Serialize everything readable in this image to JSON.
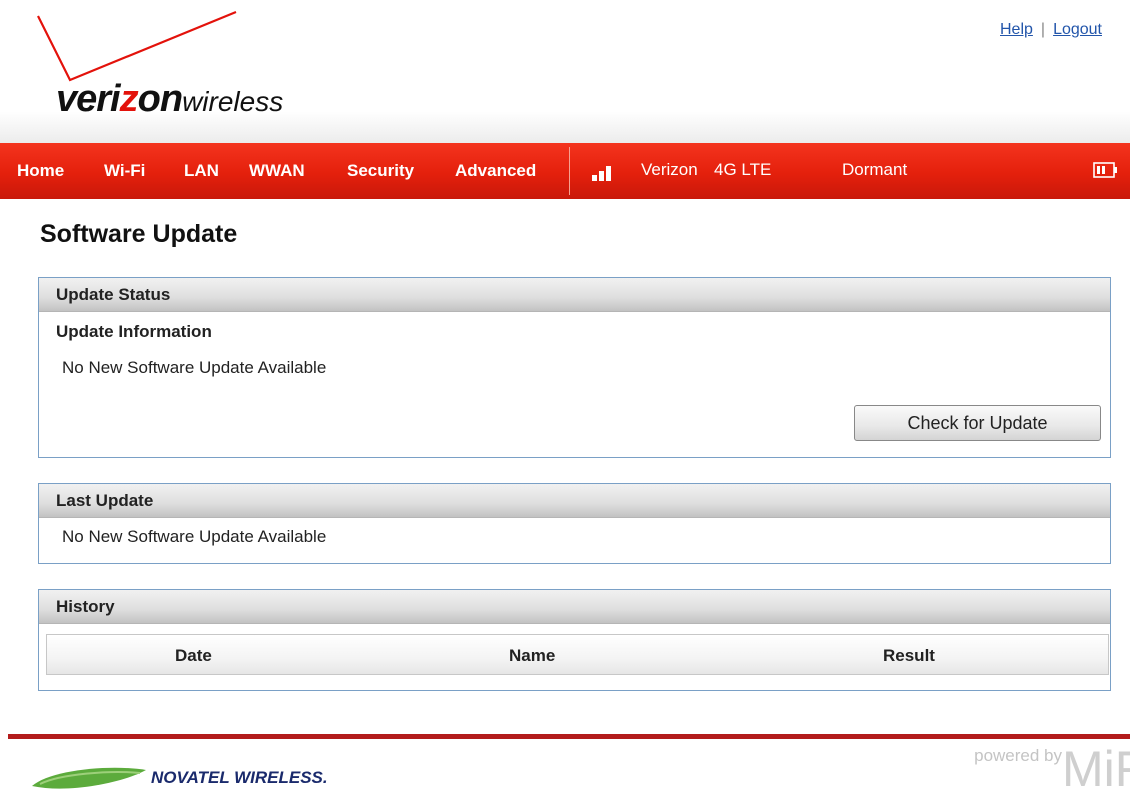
{
  "header": {
    "logo": {
      "brand_prefix": "veri",
      "brand_z": "z",
      "brand_suffix": "on",
      "brand_sub": "wireless"
    },
    "links": {
      "help": "Help",
      "logout": "Logout"
    }
  },
  "nav": {
    "items": [
      "Home",
      "Wi-Fi",
      "LAN",
      "WWAN",
      "Security",
      "Advanced"
    ],
    "signal_bars": 3,
    "carrier": "Verizon",
    "network": "4G LTE",
    "connection_status": "Dormant",
    "battery_icon": "battery-icon"
  },
  "page": {
    "title": "Software Update"
  },
  "update_status": {
    "header": "Update Status",
    "subheading": "Update Information",
    "message": "No New Software Update Available",
    "button": "Check for Update"
  },
  "last_update": {
    "header": "Last Update",
    "message": "No New Software Update Available"
  },
  "history": {
    "header": "History",
    "columns": [
      "Date",
      "Name",
      "Result"
    ],
    "rows": []
  },
  "footer": {
    "novatel": "NOVATEL WIRELESS.",
    "powered_by": "powered by",
    "mifi": "MiFi"
  },
  "colors": {
    "nav_red": "#e4200c",
    "brand_red": "#e3120b",
    "footer_rule": "#b31c1c",
    "link_blue": "#2255aa",
    "panel_border": "#7aa0c6"
  }
}
